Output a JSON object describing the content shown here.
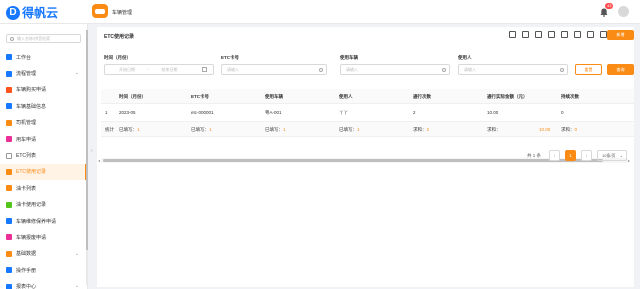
{
  "app": {
    "logo_text": "得帆云",
    "module_title": "车辆管理",
    "notification_count": "43"
  },
  "sidebar": {
    "search_placeholder": "输入名称/拼音检索",
    "items": [
      {
        "label": "工作台",
        "icon_color": "#1677ff",
        "has_children": false,
        "active": false
      },
      {
        "label": "流程管理",
        "icon_color": "#1677ff",
        "has_children": true,
        "active": false
      },
      {
        "label": "车辆购买申请",
        "icon_color": "#fa541c",
        "has_children": false,
        "active": false
      },
      {
        "label": "车辆基础信息",
        "icon_color": "#1677ff",
        "has_children": false,
        "active": false
      },
      {
        "label": "司机管理",
        "icon_color": "#fa8c16",
        "has_children": false,
        "active": false
      },
      {
        "label": "用车申请",
        "icon_color": "#eb2f96",
        "has_children": false,
        "active": false
      },
      {
        "label": "ETC列表",
        "icon_color": "#ffffff",
        "has_children": false,
        "active": false
      },
      {
        "label": "ETC使用记录",
        "icon_color": "#fa8c16",
        "has_children": false,
        "active": true
      },
      {
        "label": "油卡列表",
        "icon_color": "#fa8c16",
        "has_children": false,
        "active": false
      },
      {
        "label": "油卡使用记录",
        "icon_color": "#52c41a",
        "has_children": false,
        "active": false
      },
      {
        "label": "车辆维修保养申请",
        "icon_color": "#1677ff",
        "has_children": false,
        "active": false
      },
      {
        "label": "车辆报废申请",
        "icon_color": "#eb2f96",
        "has_children": false,
        "active": false
      },
      {
        "label": "基础数据",
        "icon_color": "#fa8c16",
        "has_children": true,
        "active": false
      },
      {
        "label": "操作手册",
        "icon_color": "#1677ff",
        "has_children": false,
        "active": false
      },
      {
        "label": "报表中心",
        "icon_color": "#1677ff",
        "has_children": true,
        "active": false
      }
    ]
  },
  "panel": {
    "title": "ETC使用记录",
    "new_button": "新增"
  },
  "filters": {
    "time_label": "时间（月份）",
    "start_placeholder": "开始日期",
    "separator": "~",
    "end_placeholder": "结束日期",
    "etc_label": "ETC卡号",
    "etc_placeholder": "请输入",
    "vehicle_label": "使用车辆",
    "vehicle_placeholder": "请输入",
    "user_label": "使用人",
    "user_placeholder": "请输入",
    "reset_button": "重置",
    "search_button": "查询"
  },
  "table": {
    "columns": [
      "时间（月份）",
      "ETC卡号",
      "使用车辆",
      "使用人",
      "通行次数",
      "通行实际金额（元）",
      "持续次数"
    ],
    "rows": [
      {
        "index": "1",
        "cells": [
          "2023-05",
          "etc-000001",
          "粤A-001",
          "丫丫",
          "2",
          "10.00",
          "0"
        ]
      }
    ],
    "summary": {
      "label": "统计",
      "cells": [
        {
          "k": "已填写：",
          "v": "1"
        },
        {
          "k": "已填写：",
          "v": "1"
        },
        {
          "k": "已填写：",
          "v": "1"
        },
        {
          "k": "已填写：",
          "v": "1"
        },
        {
          "k": "求和：",
          "v": "2"
        },
        {
          "k": "求和：",
          "v": "10.00"
        },
        {
          "k": "求和：",
          "v": "0"
        }
      ]
    }
  },
  "pagination": {
    "total": "共 1 条",
    "prev": "‹",
    "current_page": "1",
    "next": "›",
    "page_size": "10条/页"
  }
}
